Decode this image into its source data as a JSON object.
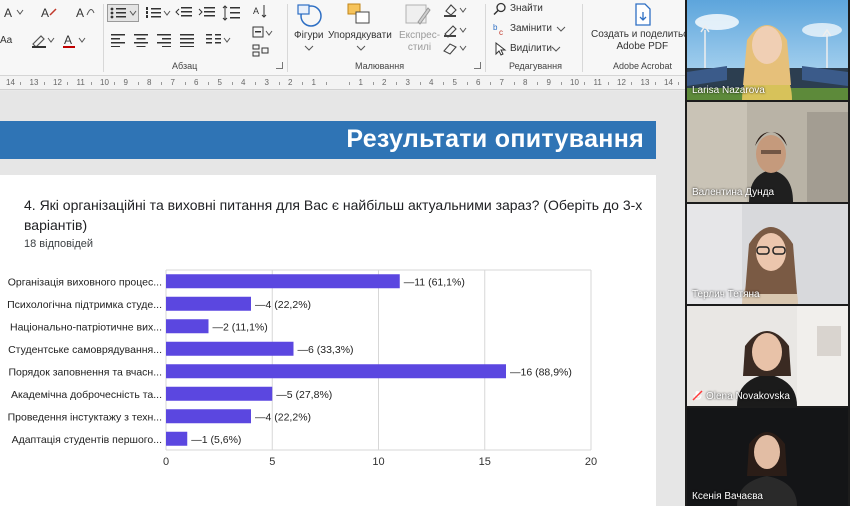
{
  "ribbon": {
    "paragraph_group": "Абзац",
    "drawing_group": "Малювання",
    "editing_group": "Редагування",
    "acrobat_group": "Adobe Acrobat",
    "shapes_label": "Фігури",
    "arrange_label": "Упорядкувати",
    "quick_styles_label": "Експрес-",
    "quick_styles_label2": "стилі",
    "find_label": "Знайти",
    "replace_label": "Замінити",
    "select_label": "Виділити",
    "adobe_label": "Создать и поделиться",
    "adobe_label2": "Adobe PDF",
    "font_size_glyph": "Aa"
  },
  "ruler_labels": [
    "14",
    "13",
    "12",
    "11",
    "10",
    "9",
    "8",
    "7",
    "6",
    "5",
    "4",
    "3",
    "2",
    "1",
    "",
    "1",
    "2",
    "3",
    "4",
    "5",
    "6",
    "7",
    "8",
    "9",
    "10",
    "11",
    "12",
    "13",
    "14"
  ],
  "slide": {
    "title": "Результати опитування",
    "question": "4. Які організаційні та виховні питання для Вас є найбільш актуальними зараз? (Оберіть до 3-х варіантів)",
    "responses": "18 відповідей"
  },
  "chart_data": {
    "type": "bar",
    "orientation": "horizontal",
    "categories": [
      "Організація виховного процес...",
      "Психологічна підтримка студе...",
      "Національно-патріотичне вих...",
      "Студентське самоврядування...",
      "Порядок заповнення та вчасн...",
      "Академічна доброчесність та...",
      "Проведення інстуктажу з техн...",
      "Адаптація студентів першого..."
    ],
    "values": [
      11,
      4,
      2,
      6,
      16,
      5,
      4,
      1
    ],
    "data_labels": [
      "11 (61,1%)",
      "4 (22,2%)",
      "2 (11,1%)",
      "6 (33,3%)",
      "16 (88,9%)",
      "5 (27,8%)",
      "4 (22,2%)",
      "1 (5,6%)"
    ],
    "xlim": [
      0,
      20
    ],
    "xticks": [
      0,
      5,
      10,
      15,
      20
    ],
    "grid": true,
    "bar_color": "#5b47e0"
  },
  "participants": [
    {
      "name": "Larisa Nazarova",
      "muted": false,
      "active": false
    },
    {
      "name": "Валентина Дунда",
      "muted": false,
      "active": false
    },
    {
      "name": "Терлич Тетяна",
      "muted": false,
      "active": false
    },
    {
      "name": "Olena Novakovskа",
      "muted": true,
      "active": false
    },
    {
      "name": "Ксенія Вачаєва",
      "muted": false,
      "active": true
    }
  ]
}
